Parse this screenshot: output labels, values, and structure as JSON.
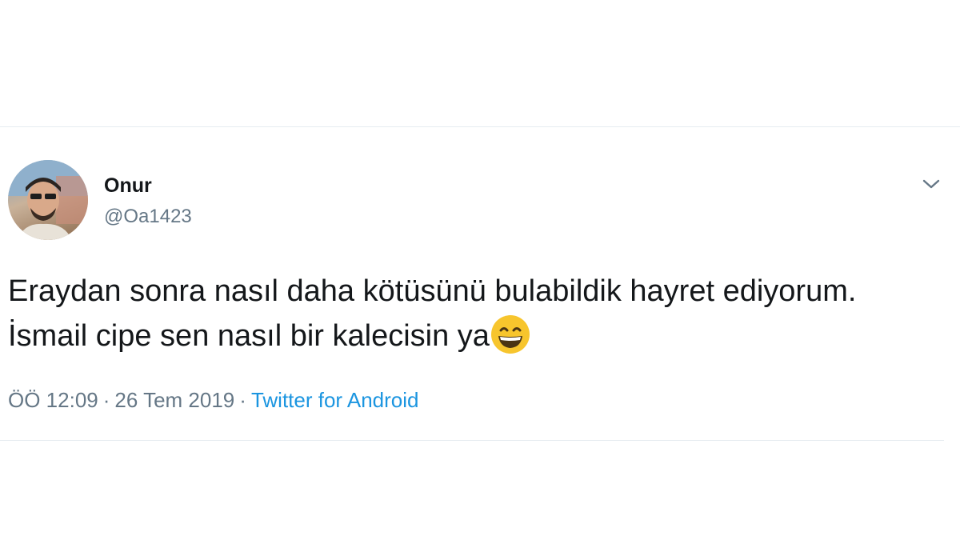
{
  "tweet": {
    "display_name": "Onur",
    "handle": "@Oa1423",
    "text": "Eraydan sonra nasıl daha kötüsünü bulabildik hayret ediyorum. İsmail cipe sen nasıl bir kalecisin ya",
    "emoji": "grinning-face-with-smiling-eyes",
    "time": "ÖÖ 12:09",
    "separator": "·",
    "date": "26 Tem 2019",
    "source": "Twitter for Android"
  },
  "icons": {
    "menu": "chevron-down-icon",
    "avatar": "avatar"
  },
  "colors": {
    "text": "#14171a",
    "secondary": "#657786",
    "link": "#1b95e0",
    "divider": "#e6ecf0"
  }
}
